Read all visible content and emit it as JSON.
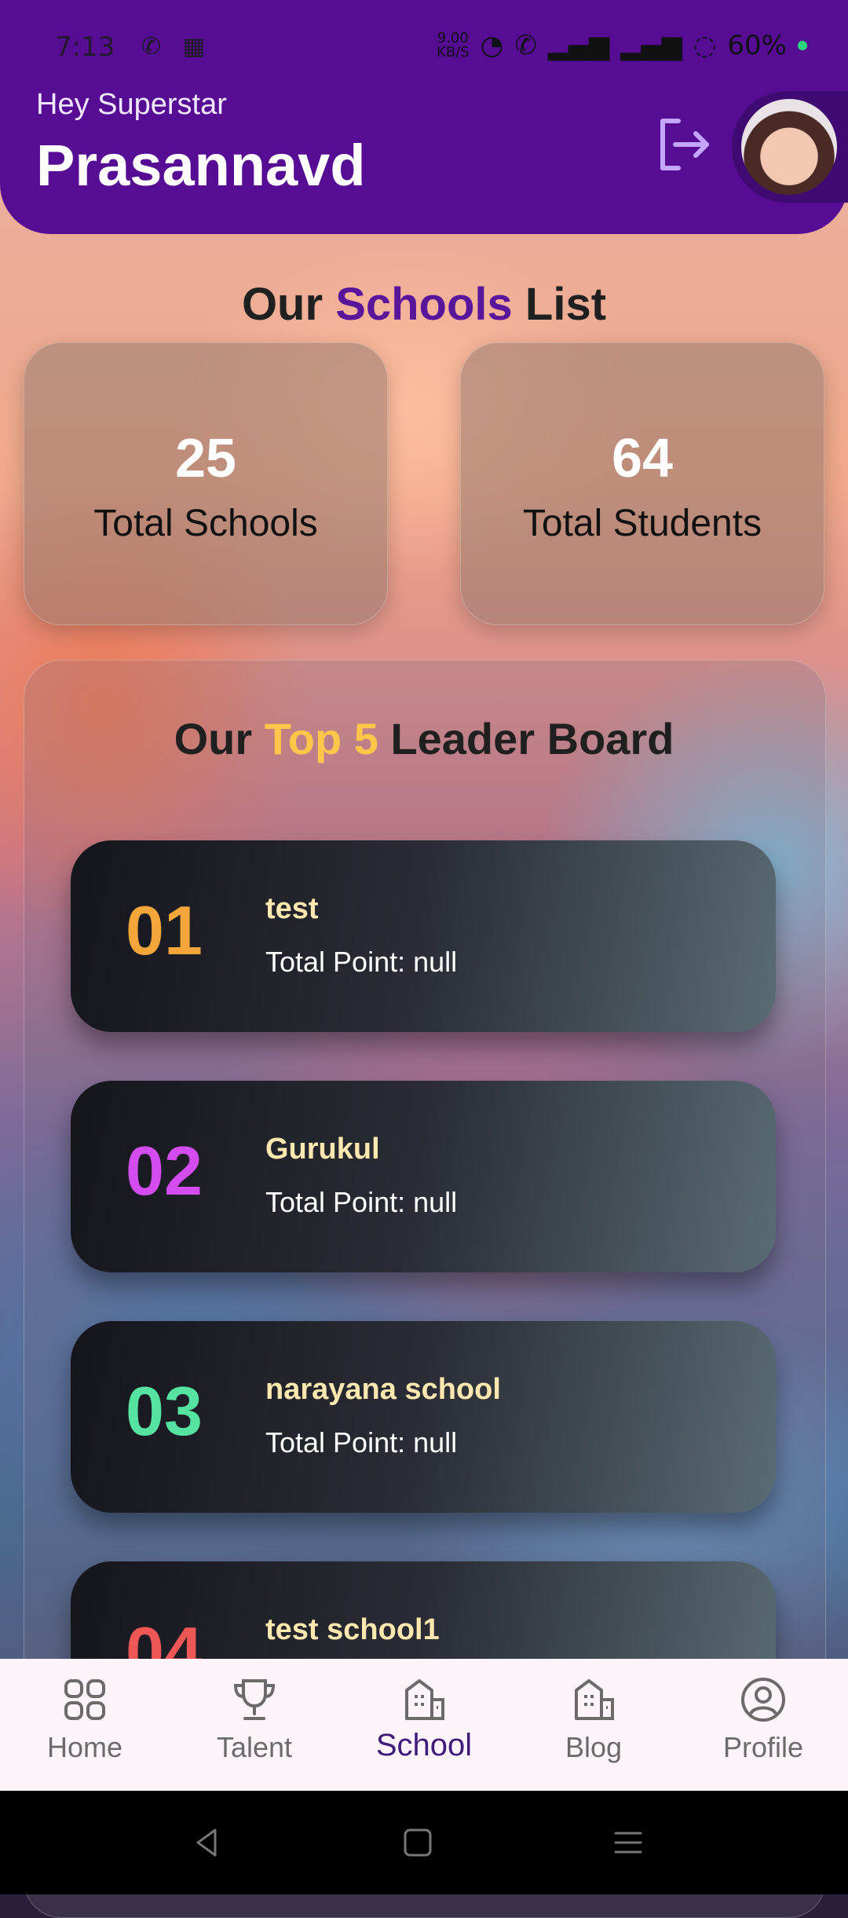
{
  "status_bar": {
    "time": "7:13",
    "net_speed_value": "9.00",
    "net_speed_unit": "KB/S",
    "battery": "60%"
  },
  "header": {
    "greeting": "Hey Superstar",
    "user_name": "Prasannavd"
  },
  "schools_section": {
    "title_prefix": "Our",
    "title_highlight": "Schools",
    "title_suffix": "List",
    "stats": [
      {
        "value": "25",
        "label": "Total Schools"
      },
      {
        "value": "64",
        "label": "Total Students"
      }
    ]
  },
  "leaderboard": {
    "title_prefix": "Our",
    "title_highlight": "Top 5",
    "title_suffix": "Leader Board",
    "rows": [
      {
        "rank": "01",
        "name": "test",
        "points": "Total Point: null",
        "color": "#f4a63b"
      },
      {
        "rank": "02",
        "name": "Gurukul",
        "points": "Total Point: null",
        "color": "#d24cf0"
      },
      {
        "rank": "03",
        "name": "narayana school",
        "points": "Total Point: null",
        "color": "#56e3a1"
      },
      {
        "rank": "04",
        "name": "test school1",
        "points": "",
        "color": "#ef5656"
      }
    ]
  },
  "bottom_nav": {
    "items": [
      {
        "label": "Home",
        "icon": "grid-icon"
      },
      {
        "label": "Talent",
        "icon": "trophy-icon"
      },
      {
        "label": "School",
        "icon": "building-icon",
        "active": true
      },
      {
        "label": "Blog",
        "icon": "building-icon"
      },
      {
        "label": "Profile",
        "icon": "account-circle-icon"
      }
    ]
  },
  "colors": {
    "header_bg": "#560d94",
    "accent_purple": "#5a169a",
    "accent_gold": "#ffc64a"
  }
}
